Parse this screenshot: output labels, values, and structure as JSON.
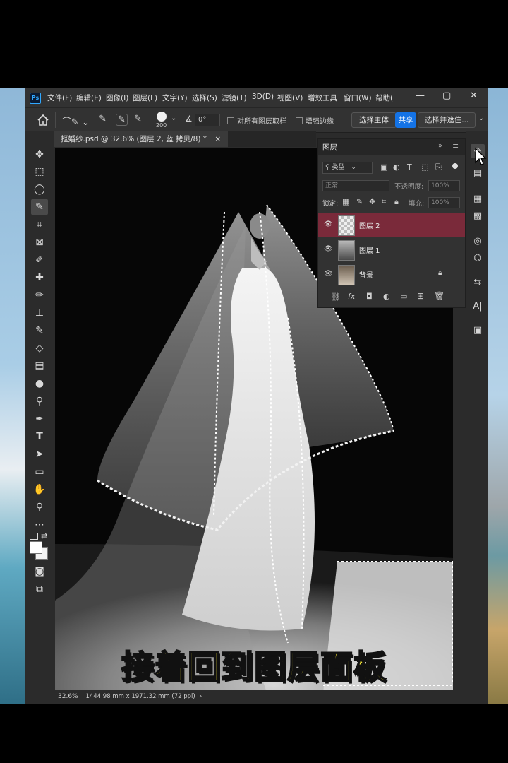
{
  "app": {
    "logo": "Ps",
    "menu": [
      "文件(F)",
      "编辑(E)",
      "图像(I)",
      "图层(L)",
      "文字(Y)",
      "选择(S)",
      "滤镜(T)",
      "3D(D)",
      "视图(V)",
      "增效工具",
      "窗口(W)",
      "帮助("
    ],
    "window_controls": [
      "—",
      "▢",
      "✕"
    ]
  },
  "options_bar": {
    "brush_size": "200",
    "angle": "0°",
    "sample_all_layers": "对所有图层取样",
    "enhance_edge": "增强边缘",
    "select_subject": "选择主体",
    "share": "共享",
    "select_and_mask": "选择并遮住..."
  },
  "document": {
    "tab_title": "抠婚纱.psd @ 32.6% (图层 2, 蓝 拷贝/8) *",
    "close": "×"
  },
  "status_bar": {
    "zoom": "32.6%",
    "dimensions": "1444.98 mm x 1971.32 mm (72 ppi)",
    "arrow": "›"
  },
  "layers_panel": {
    "title": "图层",
    "filter_kind": "类型",
    "blend_mode": "正常",
    "opacity_label": "不透明度:",
    "opacity_value": "100%",
    "lock_label": "锁定:",
    "fill_label": "填充:",
    "fill_value": "100%",
    "layers": [
      {
        "name": "图层 2",
        "selected": true,
        "locked": false
      },
      {
        "name": "图层 1",
        "selected": false,
        "locked": false
      },
      {
        "name": "背景",
        "selected": false,
        "locked": true
      }
    ],
    "footer_icons": [
      "link-icon",
      "fx-icon",
      "mask-icon",
      "adjustment-icon",
      "folder-icon",
      "new-layer-icon",
      "trash-icon"
    ]
  },
  "subtitle": "接着回到图层面板",
  "colors": {
    "selected_layer": "#7a2a3a",
    "share_button": "#1473e6",
    "subtitle": "#f4e531"
  }
}
